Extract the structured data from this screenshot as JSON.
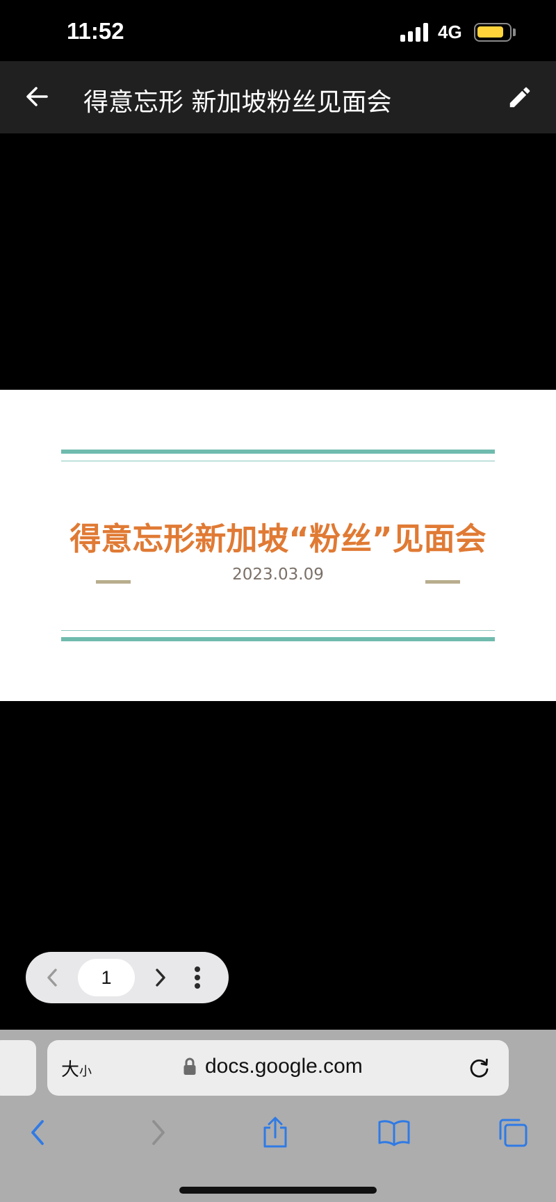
{
  "status_bar": {
    "time": "11:52",
    "network": "4G",
    "battery_level": 0.85,
    "battery_color": "#ffd43b"
  },
  "header": {
    "title": "得意忘形 新加坡粉丝见面会",
    "back_icon": "arrow-left-icon",
    "edit_icon": "pencil-icon"
  },
  "slide": {
    "title": "得意忘形新加坡“粉丝”见面会",
    "date": "2023.03.09",
    "title_color": "#e07a34",
    "rule_color": "#6fbbae"
  },
  "page_nav": {
    "current_page": "1",
    "prev_icon": "chevron-left-icon",
    "next_icon": "chevron-right-icon",
    "more_icon": "more-vertical-icon"
  },
  "browser": {
    "text_size_big": "大",
    "text_size_small": "小",
    "url": "docs.google.com",
    "reload_icon": "reload-icon",
    "toolbar": [
      "back-icon",
      "forward-icon",
      "share-icon",
      "bookmarks-icon",
      "tabs-icon"
    ],
    "accent_color": "#2f7ae5"
  }
}
